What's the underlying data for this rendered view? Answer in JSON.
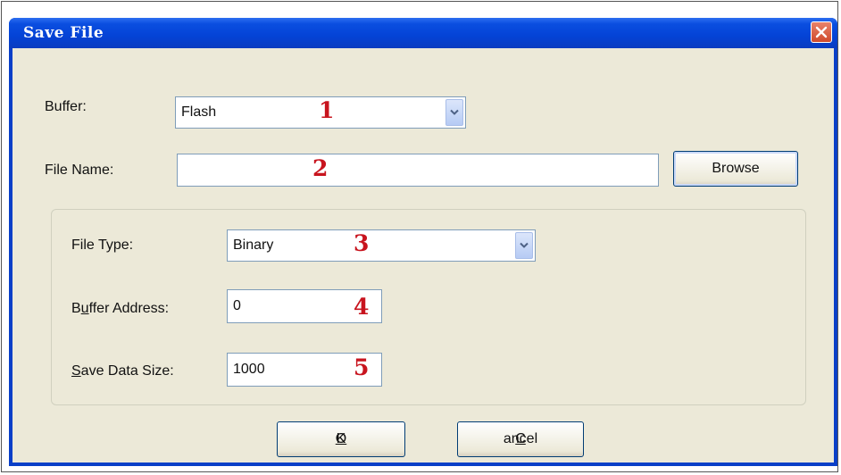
{
  "window": {
    "title": "Save File"
  },
  "buffer": {
    "label": "Buffer:",
    "value": "Flash",
    "marker": "1"
  },
  "file_name": {
    "label": "File Name:",
    "value": "",
    "marker": "2",
    "browse_label": "Browse"
  },
  "file_type": {
    "label": "File Type:",
    "value": "Binary",
    "marker": "3"
  },
  "buffer_address": {
    "label_pre": "B",
    "label_u": "u",
    "label_post": "ffer Address:",
    "value": "0",
    "marker": "4"
  },
  "save_data_size": {
    "label_u": "S",
    "label_post": "ave Data Size:",
    "value": "1000",
    "marker": "5"
  },
  "buttons": {
    "ok_u": "O",
    "ok_post": "K",
    "cancel_u": "C",
    "cancel_post": "ancel"
  },
  "icons": {
    "close": "close-icon",
    "dropdown": "chevron-down-icon"
  }
}
